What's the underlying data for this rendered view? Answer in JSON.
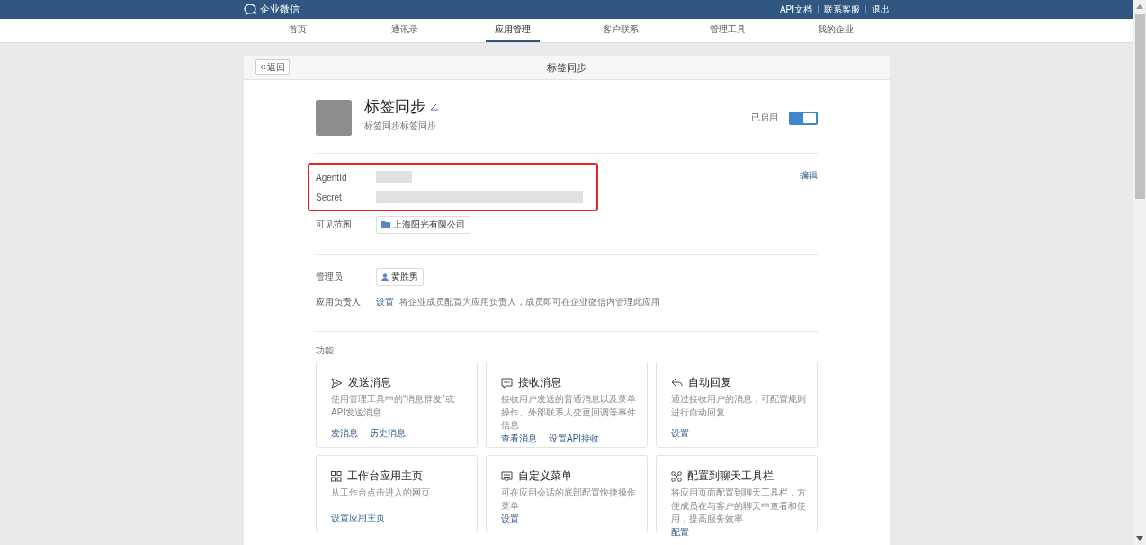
{
  "top_bar": {
    "logo_text": "企业微信",
    "links": [
      "API文档",
      "联系客服",
      "退出"
    ]
  },
  "nav": [
    {
      "label": "首页",
      "selected": false
    },
    {
      "label": "通讯录",
      "selected": false
    },
    {
      "label": "应用管理",
      "selected": true
    },
    {
      "label": "客户联系",
      "selected": false
    },
    {
      "label": "管理工具",
      "selected": false
    },
    {
      "label": "我的企业",
      "selected": false
    }
  ],
  "page": {
    "back_button": "返回",
    "title": "标签同步"
  },
  "app": {
    "name": "标签同步",
    "description": "标签同步标签同步",
    "status_label": "已启用",
    "enabled": true
  },
  "credentials": {
    "fields": [
      {
        "label": "AgentId",
        "kind": "short"
      },
      {
        "label": "Secret",
        "kind": "long"
      }
    ],
    "edit_link": "编辑"
  },
  "visibility": {
    "label": "可见范围",
    "items": [
      "上海阳光有限公司"
    ]
  },
  "admin": {
    "label": "管理员",
    "items": [
      "黄胜男"
    ]
  },
  "owner": {
    "label": "应用负责人",
    "link": "设置",
    "hint": "将企业成员配置为应用负责人，成员即可在企业微信内管理此应用"
  },
  "features": {
    "label": "功能",
    "cards": [
      {
        "kind": "send",
        "title": "发送消息",
        "description": "使用管理工具中的“消息群发”或API发送消息",
        "links": [
          "发消息",
          "历史消息"
        ]
      },
      {
        "kind": "chat",
        "title": "接收消息",
        "description": "接收用户发送的普通消息以及菜单操作、外部联系人变更回调等事件信息",
        "links": [
          "查看消息",
          "设置API接收"
        ]
      },
      {
        "kind": "reply",
        "title": "自动回复",
        "description": "通过接收用户的消息，可配置规则进行自动回复",
        "links": [
          "设置"
        ]
      },
      {
        "kind": "grid",
        "title": "工作台应用主页",
        "description": "从工作台点击进入的网页",
        "links": [
          "设置应用主页"
        ]
      },
      {
        "kind": "menu",
        "title": "自定义菜单",
        "description": "可在应用会话的底部配置快捷操作菜单",
        "links": [
          "设置"
        ]
      },
      {
        "kind": "tools",
        "title": "配置到聊天工具栏",
        "description": "将应用页面配置到聊天工具栏，方便成员在与客户的聊天中查看和使用，提高服务效率",
        "links": [
          "配置"
        ]
      }
    ]
  }
}
